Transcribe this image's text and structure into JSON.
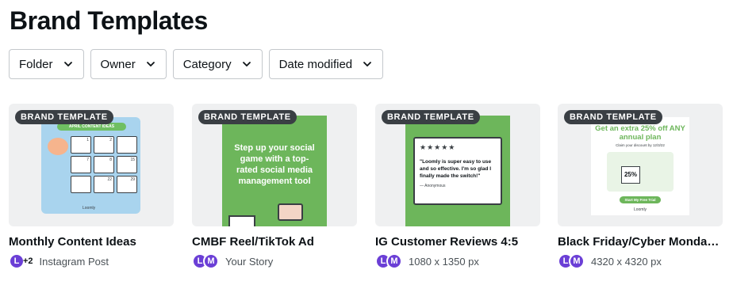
{
  "page": {
    "title": "Brand Templates"
  },
  "filters": [
    {
      "label": "Folder"
    },
    {
      "label": "Owner"
    },
    {
      "label": "Category"
    },
    {
      "label": "Date modified"
    }
  ],
  "cards": [
    {
      "badge": "BRAND TEMPLATE",
      "title": "Monthly Content Ideas",
      "avatars": [
        "L"
      ],
      "extra": "+2",
      "meta": "Instagram Post",
      "thumb": {
        "heading": "APRIL CONTENT IDEAS",
        "numbers": [
          "1",
          "2",
          "",
          "7",
          "8",
          "15",
          "",
          "22",
          "29"
        ],
        "footer": "Loomly"
      }
    },
    {
      "badge": "BRAND TEMPLATE",
      "title": "CMBF Reel/TikTok Ad",
      "avatars": [
        "L",
        "M"
      ],
      "meta": "Your Story",
      "thumb": {
        "text": "Step up your social game with a top-rated social media management tool"
      }
    },
    {
      "badge": "BRAND TEMPLATE",
      "title": "IG Customer Reviews 4:5",
      "avatars": [
        "L",
        "M"
      ],
      "meta": "1080 x 1350 px",
      "thumb": {
        "stars": "★★★★★",
        "quote": "\"Loomly is super easy to use and so effective. I'm so glad I finally made the switch!\"",
        "author": "— Anonymous"
      }
    },
    {
      "badge": "BRAND TEMPLATE",
      "title": "Black Friday/Cyber Monday S...",
      "avatars": [
        "L",
        "M"
      ],
      "meta": "4320 x 4320 px",
      "thumb": {
        "headline": "Get an extra 25% off ANY annual plan",
        "sub": "Claim your discount by 12/3/22",
        "percent": "25%",
        "cta": "Start My Free Trial",
        "logo": "Loomly"
      }
    }
  ]
}
